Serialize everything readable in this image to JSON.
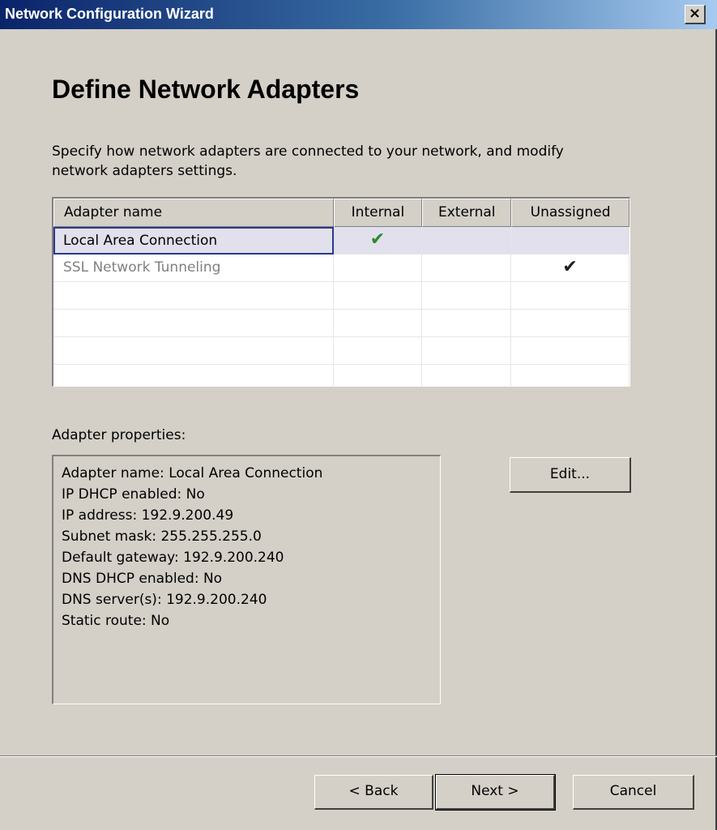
{
  "window": {
    "title": "Network Configuration Wizard",
    "close_label": "×"
  },
  "page": {
    "heading": "Define Network Adapters",
    "description": "Specify how network adapters are connected to your network, and modify network adapters settings."
  },
  "adapter_grid": {
    "columns": [
      "Adapter name",
      "Internal",
      "External",
      "Unassigned"
    ],
    "rows": [
      {
        "name": "Local Area Connection",
        "internal": "✔",
        "external": "",
        "unassigned": "",
        "selected": true,
        "disabled": false
      },
      {
        "name": "SSL Network Tunneling",
        "internal": "",
        "external": "",
        "unassigned": "✔",
        "selected": false,
        "disabled": true
      },
      {
        "name": "",
        "internal": "",
        "external": "",
        "unassigned": ""
      },
      {
        "name": "",
        "internal": "",
        "external": "",
        "unassigned": ""
      },
      {
        "name": "",
        "internal": "",
        "external": "",
        "unassigned": ""
      },
      {
        "name": "",
        "internal": "",
        "external": "",
        "unassigned": ""
      }
    ]
  },
  "properties": {
    "label": "Adapter properties:",
    "lines": [
      "Adapter name: Local Area Connection",
      "IP DHCP enabled: No",
      "IP address: 192.9.200.49",
      "Subnet mask: 255.255.255.0",
      "Default gateway: 192.9.200.240",
      "DNS DHCP enabled: No",
      "DNS server(s): 192.9.200.240",
      "Static route: No"
    ],
    "edit_label": "Edit..."
  },
  "footer": {
    "back_label": "< Back",
    "next_label": "Next >",
    "cancel_label": "Cancel"
  },
  "colors": {
    "check_internal": "#2d8a2d",
    "check_unassigned": "#202020",
    "selection_bg": "#e1e0ec",
    "titlebar_start": "#0a246a"
  }
}
